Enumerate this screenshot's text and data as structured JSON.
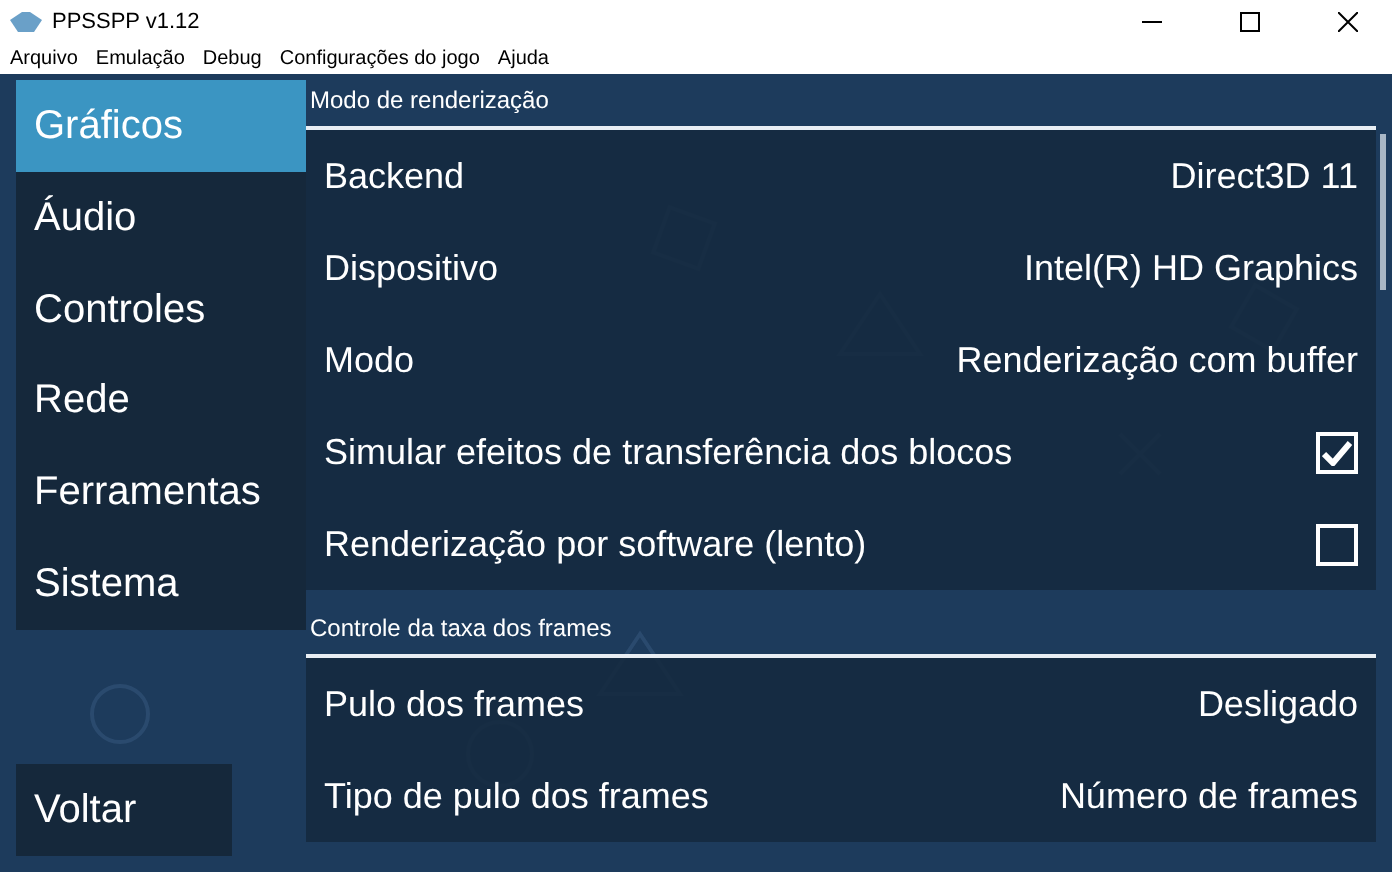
{
  "window": {
    "title": "PPSSPP v1.12"
  },
  "menu": [
    "Arquivo",
    "Emulação",
    "Debug",
    "Configurações do jogo",
    "Ajuda"
  ],
  "tabs": [
    {
      "label": "Gráficos",
      "selected": true
    },
    {
      "label": "Áudio",
      "selected": false
    },
    {
      "label": "Controles",
      "selected": false
    },
    {
      "label": "Rede",
      "selected": false
    },
    {
      "label": "Ferramentas",
      "selected": false
    },
    {
      "label": "Sistema",
      "selected": false
    }
  ],
  "back_button": "Voltar",
  "sections": [
    {
      "title": "Modo de renderização",
      "rows": [
        {
          "kind": "choice",
          "label": "Backend",
          "value": "Direct3D 11"
        },
        {
          "kind": "choice",
          "label": "Dispositivo",
          "value": "Intel(R) HD Graphics"
        },
        {
          "kind": "choice",
          "label": "Modo",
          "value": "Renderização com buffer"
        },
        {
          "kind": "checkbox",
          "label": "Simular efeitos de transferência dos blocos",
          "checked": true
        },
        {
          "kind": "checkbox",
          "label": "Renderização por software (lento)",
          "checked": false
        }
      ]
    },
    {
      "title": "Controle da taxa dos frames",
      "rows": [
        {
          "kind": "choice",
          "label": "Pulo dos frames",
          "value": "Desligado"
        },
        {
          "kind": "choice",
          "label": "Tipo de pulo dos frames",
          "value": "Número de frames"
        }
      ]
    }
  ]
}
